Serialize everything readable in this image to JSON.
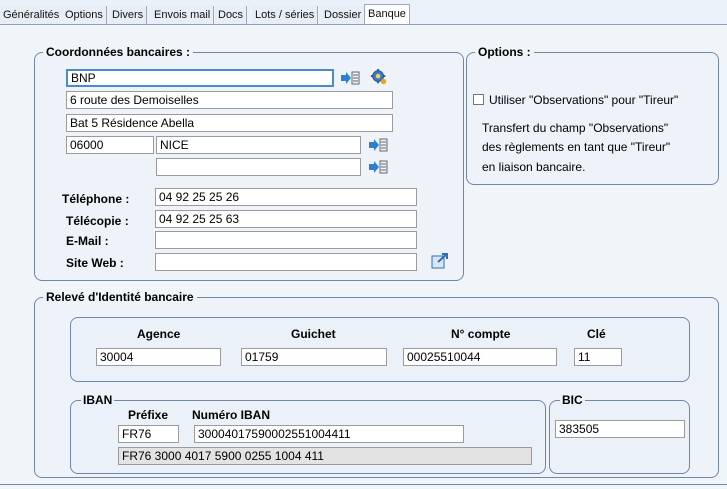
{
  "tabs": [
    "Généralités",
    "Options",
    "Divers",
    "Envois mail",
    "Docs",
    "Lots / séries",
    "Dossier",
    "Banque"
  ],
  "coordonnees": {
    "legend": "Coordonnées bancaires :",
    "banque": "BNP",
    "adresse1": "6 route des Demoiselles",
    "adresse2": "Bat 5 Résidence Abella",
    "code_postal": "06000",
    "ville": "NICE",
    "pays": "",
    "telephone_label": "Téléphone :",
    "telephone": "04 92 25 25 26",
    "telecopie_label": "Télécopie :",
    "telecopie": "04 92 25 25 63",
    "email_label": "E-Mail :",
    "email": "",
    "site_label": "Site Web :",
    "site": ""
  },
  "options": {
    "legend": "Options :",
    "checkbox_label": "Utiliser \"Observations\" pour \"Tireur\"",
    "checked": false,
    "desc1": "Transfert du champ \"Observations\"",
    "desc2": "des règlements en tant que \"Tireur\"",
    "desc3": "en liaison bancaire."
  },
  "rib": {
    "legend": "Relevé d'Identité bancaire",
    "agence_label": "Agence",
    "agence": "30004",
    "guichet_label": "Guichet",
    "guichet": "01759",
    "compte_label": "N° compte",
    "compte": "00025510044",
    "cle_label": "Clé",
    "cle": "11",
    "iban_legend": "IBAN",
    "prefixe_label": "Préfixe",
    "prefixe": "FR76",
    "numero_label": "Numéro IBAN",
    "numero": "30004017590002551004411",
    "formatted": "FR76  3000  4017  5900  0255  1004  411",
    "bic_legend": "BIC",
    "bic": "383505"
  },
  "icons": {
    "list": "list-arrow-icon",
    "settings": "gear-icon",
    "web": "external-link-icon"
  }
}
